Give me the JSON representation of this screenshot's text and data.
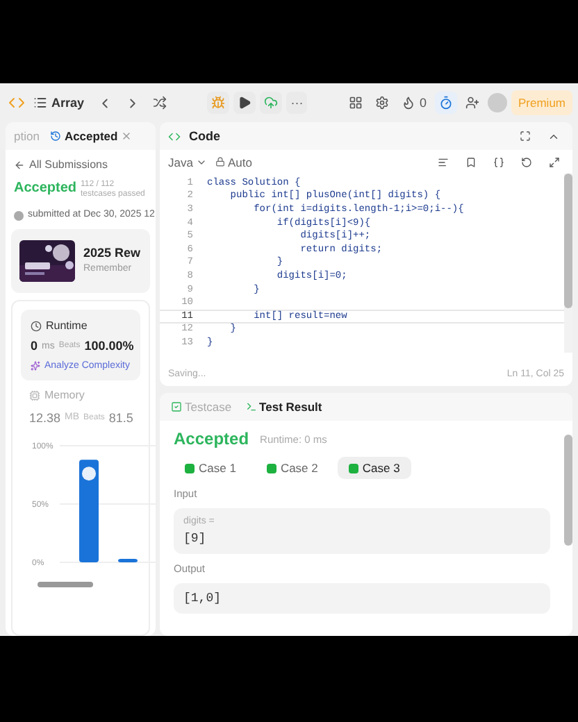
{
  "top_bar": {
    "problem_list": "Array",
    "coins": "0",
    "more": "···",
    "premium": "Premium"
  },
  "left_panel": {
    "tabs": [
      {
        "label": "ption",
        "selected": false,
        "closable": false
      },
      {
        "label": "Accepted",
        "selected": true,
        "closable": true
      }
    ],
    "back_link": "All Submissions",
    "status": "Accepted",
    "testcases": "112 / 112 testcases passed",
    "submitted": "submitted at Dec 30, 2025 12",
    "promo": {
      "kind": "picture",
      "title": "2025 Rew",
      "subtitle": "Remember"
    },
    "runtime": {
      "label": "Runtime",
      "value": "0",
      "unit": "ms",
      "beats_label": "Beats",
      "beats": "100.00%",
      "analyze": "Analyze Complexity"
    },
    "memory": {
      "label": "Memory",
      "value": "12.38",
      "unit": "MB",
      "beats_label": "Beats",
      "beats": "81.5",
      "chart_data": {
        "type": "bar",
        "values": [
          88,
          3
        ],
        "ylim": [
          0,
          100
        ],
        "yticks": [
          {
            "value": 0,
            "label": "0%"
          },
          {
            "value": 50,
            "label": "50%"
          },
          {
            "value": 100,
            "label": "100%"
          }
        ]
      }
    }
  },
  "code_panel": {
    "title": "Code",
    "language": "Java",
    "mode": "Auto",
    "lines": [
      {
        "number": "1",
        "text": "class Solution {",
        "current": false
      },
      {
        "number": "2",
        "text": "    public int[] plusOne(int[] digits) {",
        "current": false
      },
      {
        "number": "3",
        "text": "        for(int i=digits.length-1;i>=0;i--){",
        "current": false
      },
      {
        "number": "4",
        "text": "            if(digits[i]<9){",
        "current": false
      },
      {
        "number": "5",
        "text": "                digits[i]++;",
        "current": false
      },
      {
        "number": "6",
        "text": "                return digits;",
        "current": false
      },
      {
        "number": "7",
        "text": "            }",
        "current": false
      },
      {
        "number": "8",
        "text": "            digits[i]=0;",
        "current": false
      },
      {
        "number": "9",
        "text": "        }",
        "current": false
      },
      {
        "number": "10",
        "current": false
      },
      {
        "number": "11",
        "text": "        int[] result=new",
        "current": true
      },
      {
        "number": "12",
        "text": "    }",
        "current": false
      },
      {
        "number": "13",
        "text": "}",
        "current": false
      }
    ],
    "status": "Saving...",
    "cursor": "Ln 11, Col 25"
  },
  "result_panel": {
    "tabs": [
      {
        "label": "Testcase",
        "selected": false
      },
      {
        "label": "Test Result",
        "selected": true
      }
    ],
    "verdict": "Accepted",
    "runtime": "Runtime: 0 ms",
    "cases": [
      {
        "label": "Case 1",
        "selected": false,
        "passed": true
      },
      {
        "label": "Case 2",
        "selected": false,
        "passed": true
      },
      {
        "label": "Case 3",
        "selected": true,
        "passed": true
      }
    ],
    "input_label": "Input",
    "input_name": "digits =",
    "input_value": "[9]",
    "output_label": "Output",
    "output_value": "[1,0]"
  }
}
